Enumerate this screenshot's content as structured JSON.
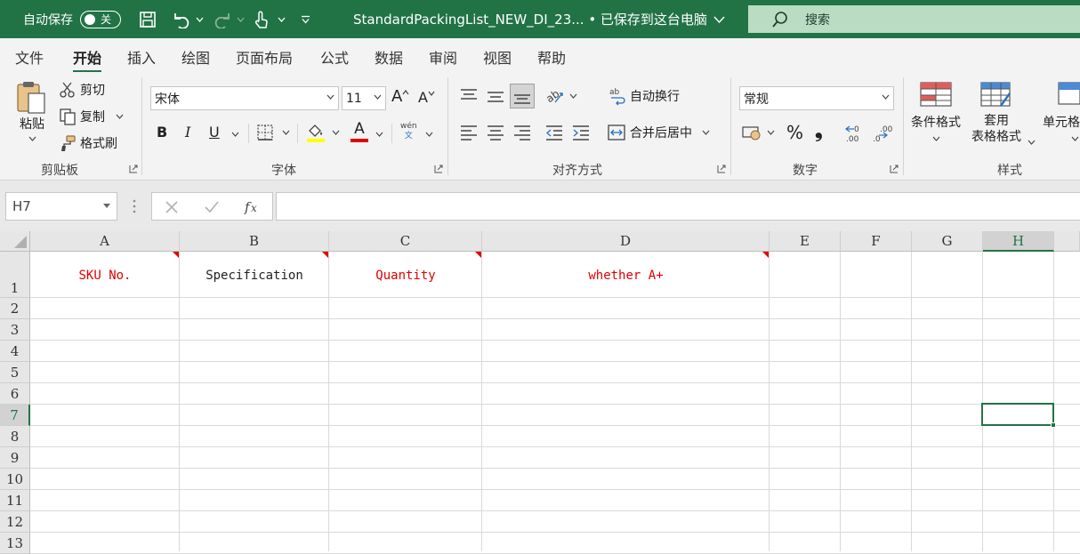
{
  "titlebar": {
    "autosave_label": "自动保存",
    "autosave_state": "关",
    "doc_title": "StandardPackingList_NEW_DI_23... • 已保存到这台电脑",
    "search_placeholder": "搜索"
  },
  "menu": {
    "tabs": [
      "文件",
      "开始",
      "插入",
      "绘图",
      "页面布局",
      "公式",
      "数据",
      "审阅",
      "视图",
      "帮助"
    ],
    "active": "开始"
  },
  "ribbon": {
    "clipboard": {
      "paste": "粘贴",
      "cut": "剪切",
      "copy": "复制",
      "format_painter": "格式刷",
      "label": "剪贴板"
    },
    "font": {
      "name": "宋体",
      "size": "11",
      "bold": "B",
      "italic": "I",
      "underline": "U",
      "phonetic_top": "wén",
      "phonetic_bottom": "文",
      "label": "字体",
      "font_color_glyph": "A",
      "grow_glyph": "A",
      "shrink_glyph": "A",
      "fill_color": "#ffff00",
      "font_color": "#e00000"
    },
    "alignment": {
      "wrap": "自动换行",
      "merge": "合并后居中",
      "label": "对齐方式"
    },
    "number": {
      "format": "常规",
      "percent": "%",
      "comma": "❟",
      "label": "数字"
    },
    "styles": {
      "conditional_line1": "条件格式",
      "table_line1": "套用",
      "table_line2": "表格格式",
      "cell_line1": "单元格",
      "label": "样式"
    }
  },
  "formula_bar": {
    "name_box": "H7",
    "formula": ""
  },
  "sheet": {
    "columns": [
      "A",
      "B",
      "C",
      "D",
      "E",
      "F",
      "G",
      "H"
    ],
    "selected_column": "H",
    "rows": [
      "1",
      "2",
      "3",
      "4",
      "5",
      "6",
      "7",
      "8",
      "9",
      "10",
      "11",
      "12",
      "13"
    ],
    "selected_row": "7",
    "selected_cell": "H7",
    "header_cells": [
      {
        "col": "A",
        "text": "SKU No.",
        "color": "#e00000",
        "comment": true
      },
      {
        "col": "B",
        "text": "Specification",
        "color": "#222222",
        "comment": true
      },
      {
        "col": "C",
        "text": "Quantity",
        "color": "#e00000",
        "comment": true
      },
      {
        "col": "D",
        "text": "whether A+",
        "color": "#e00000",
        "comment": true
      }
    ]
  },
  "colors": {
    "brand": "#217346",
    "comment_marker": "#e00000"
  }
}
